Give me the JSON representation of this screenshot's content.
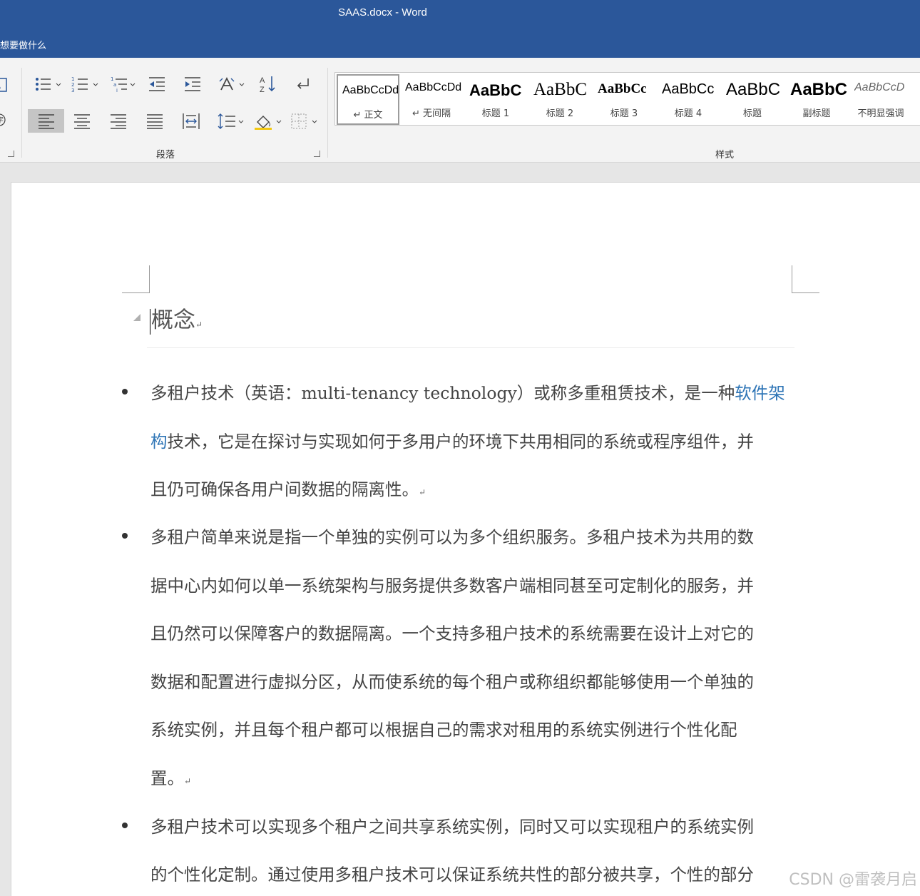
{
  "window": {
    "title": "SAAS.docx  -  Word"
  },
  "tell_me": {
    "text": "想要做什么"
  },
  "ribbon": {
    "groups": [
      {
        "label": "段落"
      },
      {
        "label": "样式"
      }
    ],
    "styles": [
      {
        "preview": "AaBbCcDd",
        "name": "↵ 正文",
        "selected": true
      },
      {
        "preview": "AaBbCcDd",
        "name": "↵ 无间隔"
      },
      {
        "preview": "AaBbC",
        "name": "标题 1"
      },
      {
        "preview": "AaBbC",
        "name": "标题 2"
      },
      {
        "preview": "AaBbCc",
        "name": "标题 3"
      },
      {
        "preview": "AaBbCc",
        "name": "标题 4"
      },
      {
        "preview": "AaBbC",
        "name": "标题"
      },
      {
        "preview": "AaBbC",
        "name": "副标题"
      },
      {
        "preview": "AaBbCcD",
        "name": "不明显强调"
      }
    ]
  },
  "document": {
    "heading": "概念",
    "paragraph_mark": "↵",
    "bullets": [
      {
        "lines": [
          {
            "before": "多租户技术（英语：multi-tenancy technology）或称多重租赁技术，是一种",
            "link": "软件架"
          },
          {
            "link": "构",
            "after": "技术，它是在探讨与实现如何于多用户的环境下共用相同的系统或程序组件，并"
          },
          {
            "before": "且仍可确保各用户间数据的隔离性。"
          }
        ]
      },
      {
        "lines": [
          {
            "before": "多租户简单来说是指一个单独的实例可以为多个组织服务。多租户技术为共用的数"
          },
          {
            "before": "据中心内如何以单一系统架构与服务提供多数客户端相同甚至可定制化的服务，并"
          },
          {
            "before": "且仍然可以保障客户的数据隔离。一个支持多租户技术的系统需要在设计上对它的"
          },
          {
            "before": "数据和配置进行虚拟分区，从而使系统的每个租户或称组织都能够使用一个单独的"
          },
          {
            "before": "系统实例，并且每个租户都可以根据自己的需求对租用的系统实例进行个性化配"
          },
          {
            "before": "置。"
          }
        ]
      },
      {
        "lines": [
          {
            "before": "多租户技术可以实现多个租户之间共享系统实例，同时又可以实现租户的系统实例"
          },
          {
            "before": "的个性化定制。通过使用多租户技术可以保证系统共性的部分被共享，个性的部分"
          }
        ]
      }
    ]
  },
  "watermark": "CSDN @雷袭月启",
  "colors": {
    "title_bar": "#2b579a",
    "link": "#2e75b6",
    "ribbon": "#f3f3f3"
  }
}
